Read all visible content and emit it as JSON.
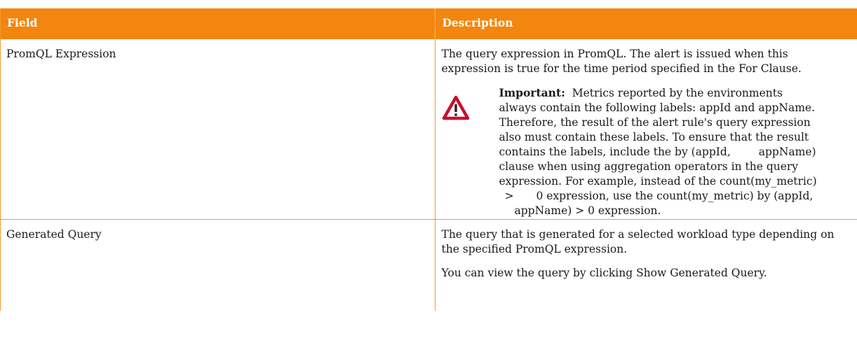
{
  "table": {
    "headers": [
      "Field",
      "Description"
    ],
    "rows": [
      {
        "field": "PromQL Expression",
        "description": "The query expression in PromQL. The alert is issued when this expression is true for the time period specified in the For Clause.",
        "note": {
          "icon": "warning-icon",
          "title": "Important:",
          "lines": [
            "Metrics reported by the environments",
            "always contain the following labels: appId and appName.",
            "Therefore, the result of the alert rule's query expression",
            "also must contain these labels. To ensure that the result",
            "contains the labels, include the by (appId,",
            "appName)",
            "clause when using aggregation operators in the query",
            "expression. For example, instead of the count(my_metric)",
            ">",
            "0 expression, use the count(my_metric) by (appId,",
            "appName) > 0 expression."
          ]
        }
      },
      {
        "field": "Generated Query",
        "description": "The query that is generated for a selected workload type depending on the specified PromQL expression.",
        "description2": "You can view the query by clicking Show Generated Query."
      }
    ]
  },
  "colors": {
    "header_bg": "#f2860f",
    "border": "#f29a2e",
    "warning_red": "#c8102e"
  }
}
